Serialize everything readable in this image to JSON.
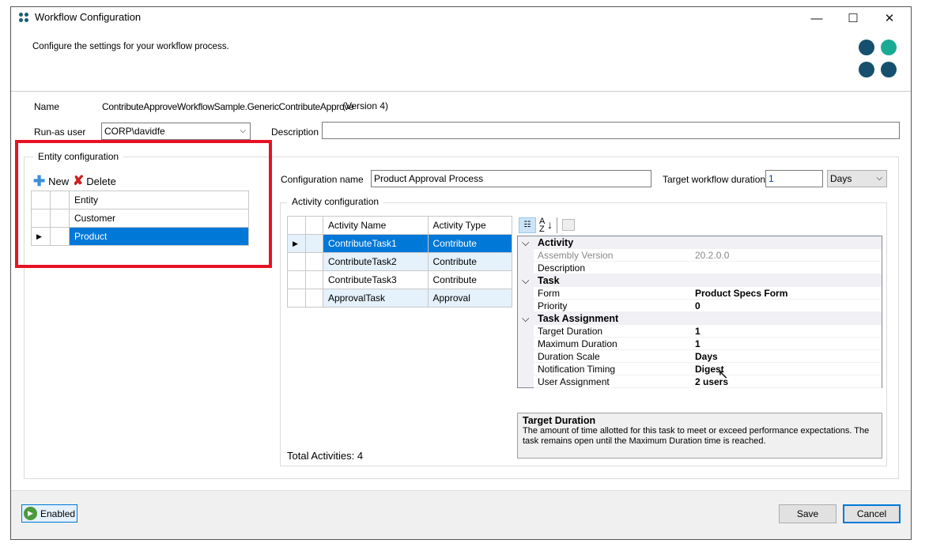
{
  "window": {
    "title": "Workflow Configuration",
    "subtitle": "Configure the settings for your workflow process.",
    "minimize": "—",
    "maximize": "☐",
    "close": "✕"
  },
  "form": {
    "name_label": "Name",
    "name_value": "ContributeApproveWorkflowSample.GenericContributeApprove",
    "version": "(Version 4)",
    "runas_label": "Run-as user",
    "runas_value": "CORP\\davidfe",
    "description_label": "Description",
    "description_value": ""
  },
  "entity": {
    "group_label": "Entity configuration",
    "new_label": "New",
    "delete_label": "Delete",
    "column": "Entity",
    "rows": [
      "Customer",
      "Product"
    ],
    "selected": "Product"
  },
  "config": {
    "name_label": "Configuration name",
    "name_value": "Product Approval Process",
    "duration_label": "Target workflow duration",
    "duration_value": "1",
    "duration_unit": "Days"
  },
  "activity": {
    "group_label": "Activity configuration",
    "columns": [
      "Activity Name",
      "Activity Type"
    ],
    "rows": [
      [
        "ContributeTask1",
        "Contribute"
      ],
      [
        "ContributeTask2",
        "Contribute"
      ],
      [
        "ContributeTask3",
        "Contribute"
      ],
      [
        "ApprovalTask",
        "Approval"
      ]
    ],
    "total": "Total Activities: 4"
  },
  "properties": {
    "categories": [
      {
        "name": "Activity",
        "items": [
          [
            "Assembly Version",
            "20.2.0.0"
          ],
          [
            "Description",
            ""
          ]
        ]
      },
      {
        "name": "Task",
        "items": [
          [
            "Form",
            "Product Specs Form"
          ],
          [
            "Priority",
            "0"
          ]
        ]
      },
      {
        "name": "Task Assignment",
        "items": [
          [
            "Target Duration",
            "1"
          ],
          [
            "Maximum Duration",
            "1"
          ],
          [
            "Duration Scale",
            "Days"
          ],
          [
            "Notification Timing",
            "Digest"
          ],
          [
            "User Assignment",
            "2 users"
          ]
        ]
      }
    ],
    "help_title": "Target Duration",
    "help_text": "The amount of time allotted for this task to meet or exceed performance expectations. The task remains open until the Maximum Duration time is reached."
  },
  "footer": {
    "enabled_label": "Enabled",
    "save_label": "Save",
    "cancel_label": "Cancel"
  },
  "colors": {
    "accent": "#0078d7",
    "highlight_box": "#e81123",
    "logo_dark": "#16506e",
    "logo_teal": "#1aab95"
  }
}
